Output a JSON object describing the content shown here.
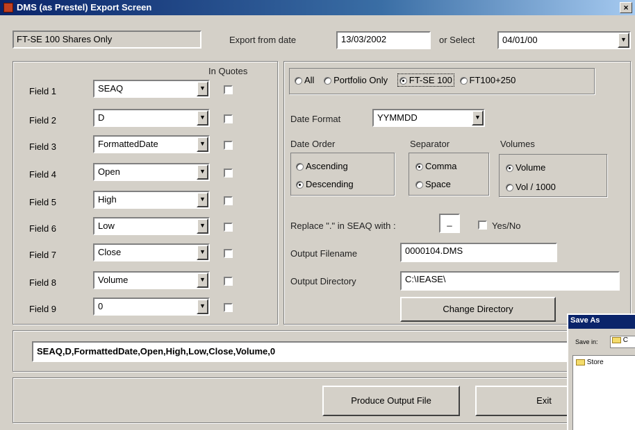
{
  "window": {
    "title": "DMS (as Prestel) Export Screen",
    "close": "×"
  },
  "header": {
    "scope": "FT-SE 100 Shares Only",
    "export_from_label": "Export from date",
    "export_from_value": "13/03/2002",
    "or_select_label": "or Select",
    "or_select_value": "04/01/00"
  },
  "fields": {
    "in_quotes_label": "In Quotes",
    "rows": [
      {
        "label": "Field 1",
        "value": "SEAQ"
      },
      {
        "label": "Field 2",
        "value": "D"
      },
      {
        "label": "Field 3",
        "value": "FormattedDate"
      },
      {
        "label": "Field 4",
        "value": "Open"
      },
      {
        "label": "Field 5",
        "value": "High"
      },
      {
        "label": "Field 6",
        "value": "Low"
      },
      {
        "label": "Field 7",
        "value": "Close"
      },
      {
        "label": "Field 8",
        "value": "Volume"
      },
      {
        "label": "Field 9",
        "value": "0"
      }
    ]
  },
  "options": {
    "scope_radios": [
      "All",
      "Portfolio Only",
      "FT-SE 100",
      "FT100+250"
    ],
    "date_format_label": "Date Format",
    "date_format_value": "YYMMDD",
    "date_order_label": "Date Order",
    "date_order_options": [
      "Ascending",
      "Descending"
    ],
    "separator_label": "Separator",
    "separator_options": [
      "Comma",
      "Space"
    ],
    "volumes_label": "Volumes",
    "volumes_options": [
      "Volume",
      "Vol / 1000"
    ],
    "replace_label": "Replace \".\" in SEAQ with :",
    "replace_value": "_",
    "yesno_label": "Yes/No",
    "output_filename_label": "Output Filename",
    "output_filename_value": "0000104.DMS",
    "output_directory_label": "Output Directory",
    "output_directory_value": "C:\\IEASE\\",
    "change_directory_label": "Change Directory"
  },
  "summary": "SEAQ,D,FormattedDate,Open,High,Low,Close,Volume,0",
  "footer": {
    "produce_label": "Produce Output File",
    "exit_label": "Exit"
  },
  "save_as": {
    "title": "Save As",
    "save_in_label": "Save in:",
    "save_in_value": "C",
    "folder": "Store"
  }
}
